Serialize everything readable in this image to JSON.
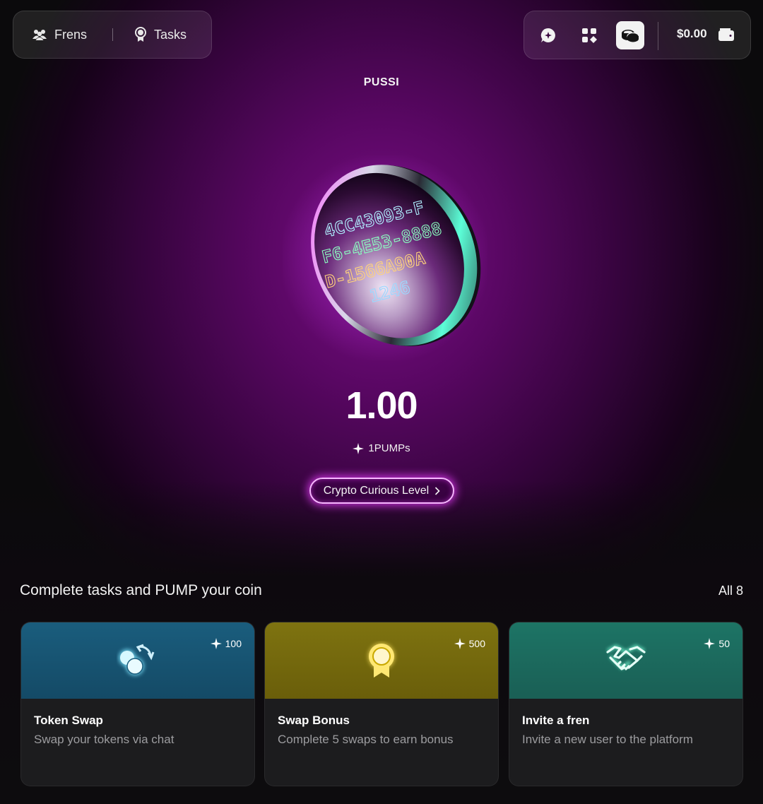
{
  "nav": {
    "frens_label": "Frens",
    "tasks_label": "Tasks"
  },
  "toolbar": {
    "balance": "$0.00",
    "icons": [
      "chat-plus-icon",
      "apps-grid-icon",
      "coins-stack-icon",
      "wallet-icon"
    ],
    "active_icon": "coins-stack-icon"
  },
  "coin": {
    "name": "PUSSI",
    "value": "1.00",
    "pumps_label": "1PUMPs",
    "level_label": "Crypto Curious Level",
    "engraving": [
      "4CC43093-F",
      "F6-4E53-8888",
      "D-1566A90A",
      "1246"
    ]
  },
  "tasks_section": {
    "title": "Complete tasks and PUMP your coin",
    "all_label": "All 8",
    "cards": [
      {
        "title": "Token Swap",
        "description": "Swap your tokens via chat",
        "reward": "100",
        "color": "#1a5d7d",
        "icon": "swap-coins-icon"
      },
      {
        "title": "Swap Bonus",
        "description": "Complete 5 swaps to earn bonus",
        "reward": "500",
        "color": "#7e7310",
        "icon": "medal-icon"
      },
      {
        "title": "Invite a fren",
        "description": "Invite a new user to the platform",
        "reward": "50",
        "color": "#1d7465",
        "icon": "handshake-icon"
      }
    ]
  },
  "colors": {
    "accent_glow": "#eb3cff",
    "background": "#0d0c0e"
  }
}
